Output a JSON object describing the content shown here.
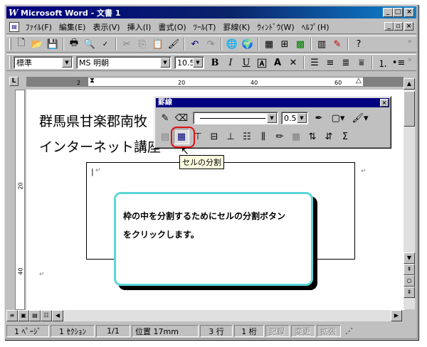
{
  "window": {
    "title": "Microsoft Word - 文書 1",
    "logo": "W",
    "minimize": "_",
    "maximize": "□",
    "close": "×"
  },
  "menu": {
    "items": [
      "ﾌｧｲﾙ(F)",
      "編集(E)",
      "表示(V)",
      "挿入(I)",
      "書式(O)",
      "ﾂｰﾙ(T)",
      "罫線(K)",
      "ｳｨﾝﾄﾞｳ(W)",
      "ﾍﾙﾌﾟ(H)"
    ],
    "mdi": [
      "_",
      "▫",
      "×"
    ]
  },
  "formatting": {
    "style": "標準",
    "font": "MS 明朝",
    "size": "10.5"
  },
  "ruler": {
    "marks": [
      "2",
      "20",
      "40",
      "60"
    ]
  },
  "vruler": {
    "marks": [
      "20",
      "40"
    ]
  },
  "document": {
    "line1": "群馬県甘楽郡南牧",
    "line2": "インターネット講座"
  },
  "borders_toolbar": {
    "title": "罫線",
    "line_weight": "0.5",
    "close": "×"
  },
  "tooltip": "セルの分割",
  "callout": {
    "line1": "枠の中を分割するためにセルの分割ボタン",
    "line2": "をクリックします。"
  },
  "statusbar": {
    "page": "1 ﾍﾟｰｼﾞ",
    "section": "1 ｾｸｼｮﾝ",
    "pages": "1/1",
    "position": "位置 17mm",
    "line": "3 行",
    "column": "1 桁",
    "rec": "記録",
    "trk": "変更",
    "ext": "拡張"
  },
  "colors": {
    "title_bar": "#000080",
    "callout_border": "#5cd6d6",
    "highlight": "#e01010",
    "tooltip_bg": "#ffffe1"
  }
}
